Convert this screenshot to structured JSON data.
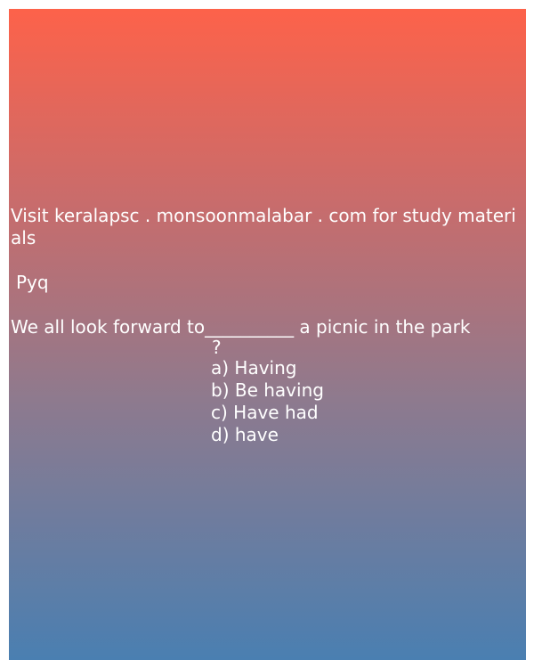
{
  "card": {
    "gradient_top": "#fd624a",
    "gradient_bottom": "#4a7fb1",
    "text_color": "#ffffff"
  },
  "promo": "Visit keralapsc . monsoonmalabar . com for study materials",
  "tag": "Pyq",
  "question": {
    "line": "We all look forward to__________ a picnic in the park",
    "end": "?"
  },
  "options": [
    "a) Having",
    "b) Be having",
    "c) Have had",
    "d) have"
  ]
}
